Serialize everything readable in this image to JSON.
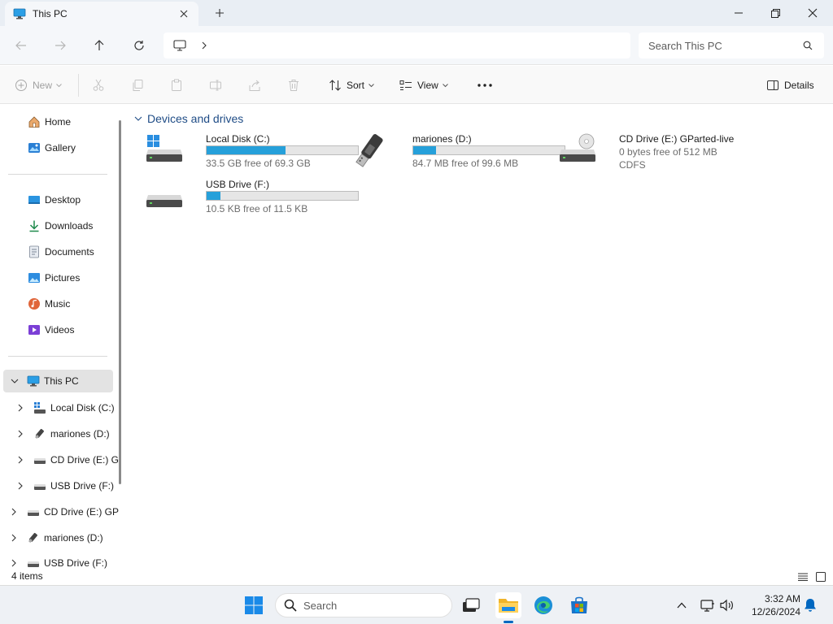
{
  "window": {
    "tab_title": "This PC",
    "controls": {
      "minimize": "minimize",
      "maximize": "maximize",
      "close": "close"
    }
  },
  "address": {
    "search_placeholder": "Search This PC"
  },
  "commands": {
    "new": "New",
    "sort": "Sort",
    "view": "View",
    "details": "Details"
  },
  "sidebar": {
    "quick": [
      {
        "label": "Home",
        "icon": "home-icon"
      },
      {
        "label": "Gallery",
        "icon": "gallery-icon"
      }
    ],
    "pinned": [
      {
        "label": "Desktop",
        "icon": "desktop-icon"
      },
      {
        "label": "Downloads",
        "icon": "downloads-icon"
      },
      {
        "label": "Documents",
        "icon": "documents-icon"
      },
      {
        "label": "Pictures",
        "icon": "pictures-icon"
      },
      {
        "label": "Music",
        "icon": "music-icon"
      },
      {
        "label": "Videos",
        "icon": "videos-icon"
      }
    ],
    "this_pc": "This PC",
    "pc_children": [
      {
        "label": "Local Disk (C:)"
      },
      {
        "label": "mariones (D:)"
      },
      {
        "label": "CD Drive (E:) G"
      },
      {
        "label": "USB Drive (F:)"
      }
    ],
    "roots": [
      {
        "label": "CD Drive (E:) GP"
      },
      {
        "label": "mariones (D:)"
      },
      {
        "label": "USB Drive (F:)"
      }
    ]
  },
  "main": {
    "group_title": "Devices and drives",
    "drives": [
      {
        "name": "Local Disk (C:)",
        "free_text": "33.5 GB free of 69.3 GB",
        "used_fraction": 0.52,
        "icon": "local-disk-icon"
      },
      {
        "name": "mariones (D:)",
        "free_text": "84.7 MB free of 99.6 MB",
        "used_fraction": 0.15,
        "icon": "usb-stick-icon"
      },
      {
        "name": "CD Drive (E:) GParted-live",
        "free_text": "0 bytes free of 512 MB",
        "filesystem": "CDFS",
        "icon": "cd-drive-icon"
      },
      {
        "name": "USB Drive (F:)",
        "free_text": "10.5 KB free of 11.5 KB",
        "used_fraction": 0.09,
        "icon": "usb-drive-icon"
      }
    ]
  },
  "status": {
    "item_count": "4 items"
  },
  "taskbar": {
    "search_placeholder": "Search",
    "time": "3:32 AM",
    "date": "12/26/2024"
  },
  "colors": {
    "accent": "#0067c0",
    "usage_bar": "#26a0da",
    "group_header": "#1f4c86"
  }
}
